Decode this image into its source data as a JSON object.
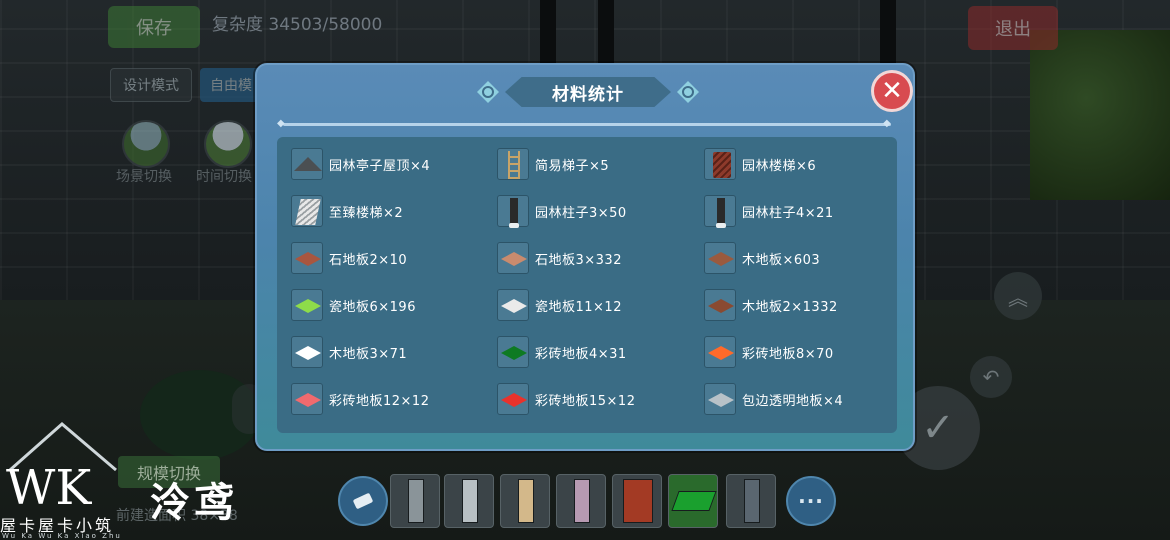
{
  "hud": {
    "save_label": "保存",
    "complexity": "复杂度 34503/58000",
    "exit_label": "退出",
    "design_mode_label": "设计模式",
    "free_mode_label": "自由模",
    "scene_switch_label": "场景切换",
    "time_switch_label": "时间切换",
    "rule_button_label": "规模切换",
    "build_area_label": "前建造面积 38×38"
  },
  "modal": {
    "title": "材料统计",
    "close_label": "✕",
    "accent": "#d84b50",
    "items": [
      {
        "label": "园林亭子屋顶×4",
        "icon": "roof-icon"
      },
      {
        "label": "简易梯子×5",
        "icon": "ladder-icon"
      },
      {
        "label": "园林楼梯×6",
        "icon": "red-stair-icon"
      },
      {
        "label": "至臻楼梯×2",
        "icon": "stair-icon"
      },
      {
        "label": "园林柱子3×50",
        "icon": "pillar-icon"
      },
      {
        "label": "园林柱子4×21",
        "icon": "pillar-icon"
      },
      {
        "label": "石地板2×10",
        "icon": "tile-icon",
        "color": "#a8563f"
      },
      {
        "label": "石地板3×332",
        "icon": "tile-icon",
        "color": "#c98b6e"
      },
      {
        "label": "木地板×603",
        "icon": "tile-icon",
        "color": "#9a5a3e"
      },
      {
        "label": "瓷地板6×196",
        "icon": "tile-icon",
        "color": "#8edc4a"
      },
      {
        "label": "瓷地板11×12",
        "icon": "tile-icon",
        "color": "#eaeaea"
      },
      {
        "label": "木地板2×1332",
        "icon": "tile-icon",
        "color": "#8a4a31"
      },
      {
        "label": "木地板3×71",
        "icon": "tile-icon",
        "color": "#ffffff"
      },
      {
        "label": "彩砖地板4×31",
        "icon": "tile-icon",
        "color": "#0e7a22"
      },
      {
        "label": "彩砖地板8×70",
        "icon": "tile-icon",
        "color": "#ff6a2a"
      },
      {
        "label": "彩砖地板12×12",
        "icon": "tile-icon",
        "color": "#f06a6e"
      },
      {
        "label": "彩砖地板15×12",
        "icon": "tile-icon",
        "color": "#e8322c"
      },
      {
        "label": "包边透明地板×4",
        "icon": "tile-icon",
        "color": "#b8c2c8"
      }
    ]
  },
  "hotbar": {
    "more_label": "···"
  },
  "watermark": {
    "letters": "WK",
    "name": "泠鸢",
    "sub": "屋卡屋卡小筑",
    "pinyin": "Wu Ka Wu Ka Xiao Zhu"
  }
}
